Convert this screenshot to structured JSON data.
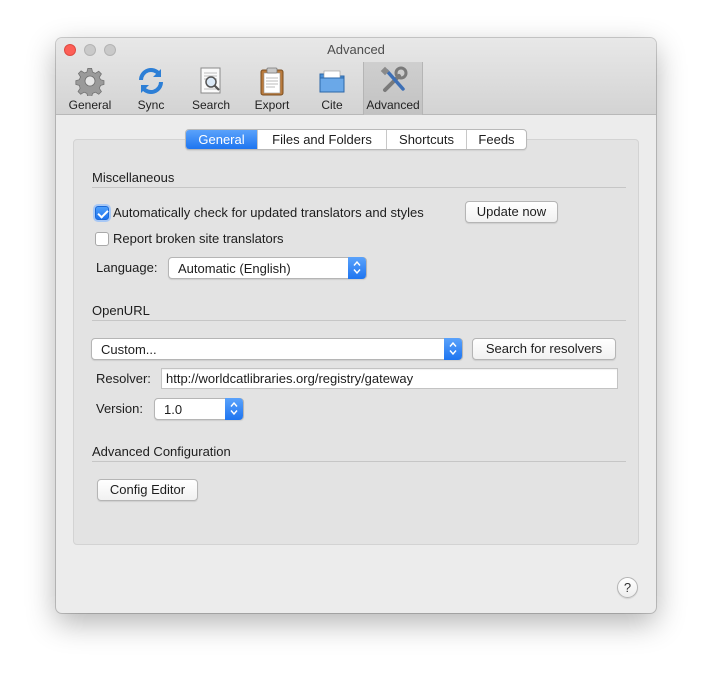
{
  "window": {
    "title": "Advanced"
  },
  "toolbar": {
    "items": [
      {
        "label": "General",
        "icon": "gear-icon",
        "selected": false
      },
      {
        "label": "Sync",
        "icon": "sync-icon",
        "selected": false
      },
      {
        "label": "Search",
        "icon": "search-document-icon",
        "selected": false
      },
      {
        "label": "Export",
        "icon": "clipboard-icon",
        "selected": false
      },
      {
        "label": "Cite",
        "icon": "folder-icon",
        "selected": false
      },
      {
        "label": "Advanced",
        "icon": "tools-icon",
        "selected": true
      }
    ]
  },
  "tabs": [
    {
      "label": "General",
      "active": true
    },
    {
      "label": "Files and Folders",
      "active": false
    },
    {
      "label": "Shortcuts",
      "active": false
    },
    {
      "label": "Feeds",
      "active": false
    }
  ],
  "misc": {
    "title": "Miscellaneous",
    "auto_check_label": "Automatically check for updated translators and styles",
    "auto_check_checked": true,
    "update_now_label": "Update now",
    "report_broken_label": "Report broken site translators",
    "report_broken_checked": false,
    "language_label": "Language:",
    "language_value": "Automatic (English)"
  },
  "openurl": {
    "title": "OpenURL",
    "resolver_select_value": "Custom...",
    "search_resolvers_label": "Search for resolvers",
    "resolver_label": "Resolver:",
    "resolver_value": "http://worldcatlibraries.org/registry/gateway",
    "version_label": "Version:",
    "version_value": "1.0"
  },
  "advanced_config": {
    "title": "Advanced Configuration",
    "config_editor_label": "Config Editor"
  },
  "help": {
    "label": "?"
  },
  "colors": {
    "accent": "#1e75f0",
    "close": "#fd5f57"
  }
}
